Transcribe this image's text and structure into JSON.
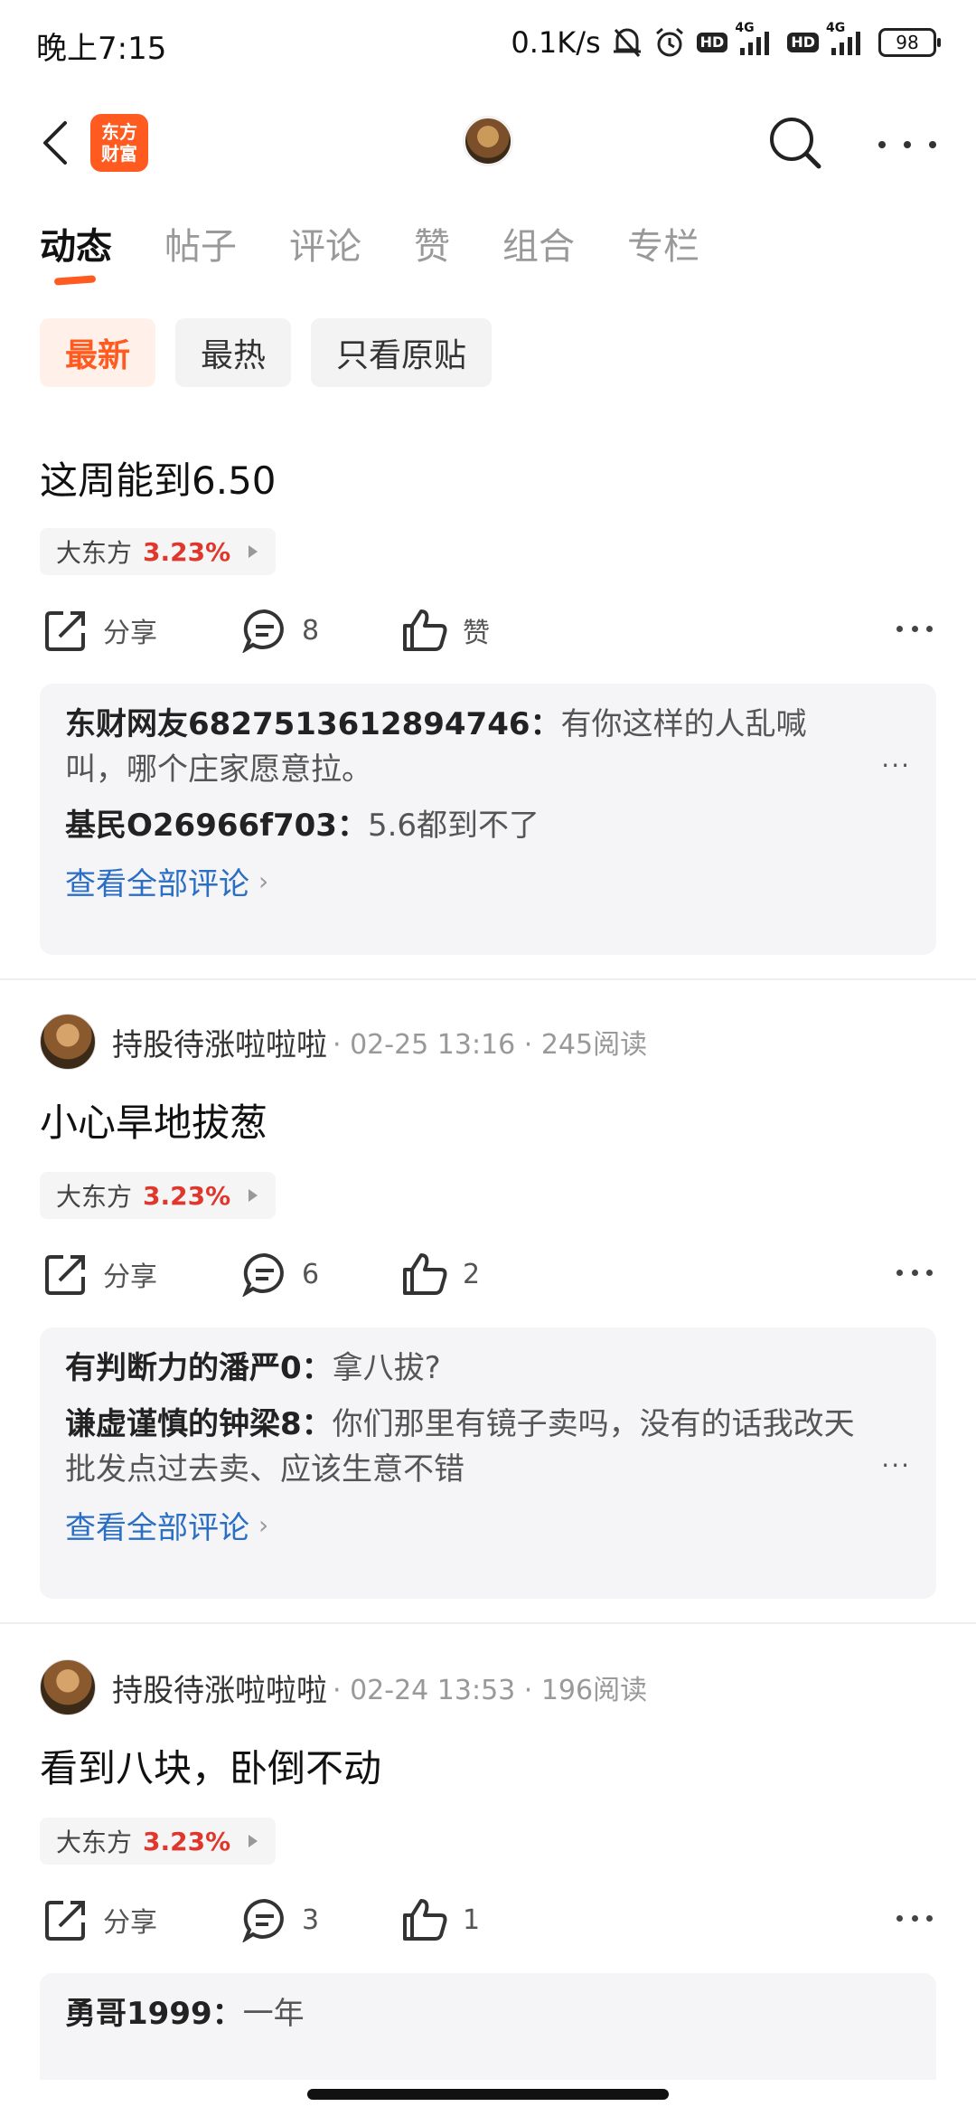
{
  "status_bar": {
    "time": "晚上7:15",
    "network_speed": "0.1K/s",
    "signal_1": "4G",
    "signal_2": "4G",
    "hd_1": "HD",
    "hd_2": "HD",
    "battery": "98"
  },
  "navbar": {
    "logo_line1": "东方",
    "logo_line2": "财富",
    "icons": [
      "back-arrow-icon",
      "search-icon",
      "more-icon"
    ]
  },
  "tabs": [
    {
      "label": "动态",
      "active": true
    },
    {
      "label": "帖子",
      "active": false
    },
    {
      "label": "评论",
      "active": false
    },
    {
      "label": "赞",
      "active": false
    },
    {
      "label": "组合",
      "active": false
    },
    {
      "label": "专栏",
      "active": false
    }
  ],
  "filters": [
    {
      "label": "最新",
      "active": true
    },
    {
      "label": "最热",
      "active": false
    },
    {
      "label": "只看原贴",
      "active": false
    }
  ],
  "colors": {
    "accent": "#ff5a1f",
    "rise": "#e0372c",
    "link": "#2a6fc4"
  },
  "posts": [
    {
      "text": "这周能到6.50",
      "stock_name": "大东方",
      "stock_change": "3.23%",
      "share_label": "分享",
      "comment_count": "8",
      "like_label": "赞",
      "comments": [
        {
          "user": "东财网友6827513612894746：",
          "text": "有你这样的人乱喊叫，哪个庄家愿意拉。"
        },
        {
          "user": "基民O26966f703：",
          "text": "5.6都到不了"
        }
      ],
      "view_all": "查看全部评论"
    },
    {
      "author": "持股待涨啦啦啦",
      "meta": "· 02-25 13:16 · 245阅读",
      "text": "小心旱地拔葱",
      "stock_name": "大东方",
      "stock_change": "3.23%",
      "share_label": "分享",
      "comment_count": "6",
      "like_label": "2",
      "comments": [
        {
          "user": "有判断力的潘严0：",
          "text": "拿八拔?"
        },
        {
          "user": "谦虚谨慎的钟梁8：",
          "text": "你们那里有镜子卖吗，没有的话我改天批发点过去卖、应该生意不错"
        }
      ],
      "view_all": "查看全部评论"
    },
    {
      "author": "持股待涨啦啦啦",
      "meta": "· 02-24 13:53 · 196阅读",
      "text": "看到八块，卧倒不动",
      "stock_name": "大东方",
      "stock_change": "3.23%",
      "share_label": "分享",
      "comment_count": "3",
      "like_label": "1",
      "comments": [
        {
          "user": "勇哥1999：",
          "text": "一年"
        }
      ]
    }
  ]
}
